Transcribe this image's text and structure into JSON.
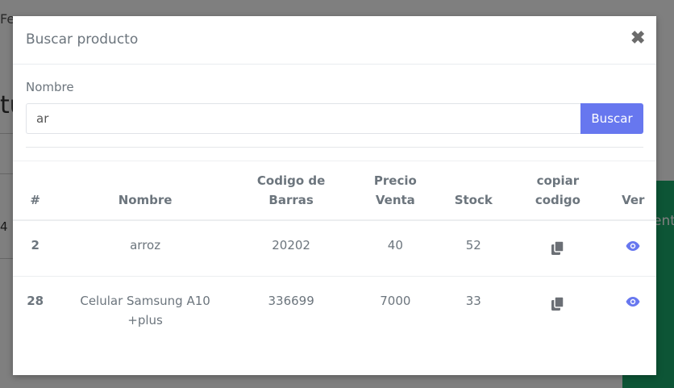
{
  "background": {
    "fragment_top": "Fe",
    "fragment_big": "tu",
    "fragment_num": "4",
    "fragment_green": "ent"
  },
  "modal": {
    "title": "Buscar producto",
    "close_symbol": "✖",
    "form": {
      "label": "Nombre",
      "input_value": "ar",
      "button_label": "Buscar"
    },
    "table": {
      "headers": [
        "#",
        "Nombre",
        "Codigo de Barras",
        "Precio Venta",
        "Stock",
        "copiar codigo",
        "Ver"
      ],
      "rows": [
        {
          "id": "2",
          "name": "arroz",
          "barcode": "20202",
          "price": "40",
          "stock": "52"
        },
        {
          "id": "28",
          "name": "Celular Samsung A10 +plus",
          "barcode": "336699",
          "price": "7000",
          "stock": "33"
        }
      ]
    }
  },
  "colors": {
    "primary": "#6777ef",
    "icon_gray": "#6b6f75",
    "text_muted": "#6c757d"
  },
  "icons": {
    "copy": "copy-icon",
    "view": "eye-icon",
    "close": "close-icon"
  }
}
